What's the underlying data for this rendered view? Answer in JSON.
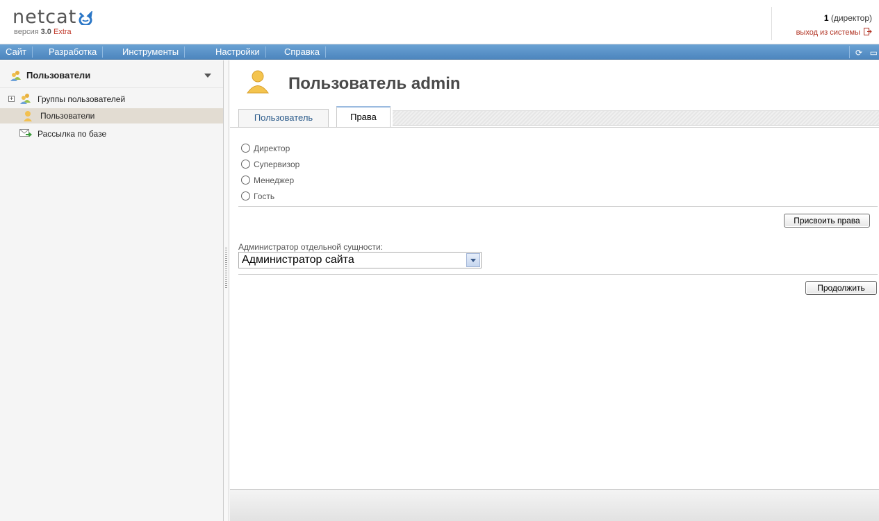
{
  "header": {
    "logo": "netcat",
    "version_prefix": "версия",
    "version_number": "3.0",
    "version_edition": "Extra",
    "user_id": "1",
    "user_role": "(директор)",
    "logout_label": "выход из системы"
  },
  "menu": {
    "items": [
      "Сайт",
      "Разработка",
      "Инструменты",
      "Настройки",
      "Справка"
    ]
  },
  "sidebar": {
    "title": "Пользователи",
    "items": [
      {
        "label": "Группы пользователей",
        "icon": "user-group-icon",
        "expandable": true
      },
      {
        "label": "Пользователи",
        "icon": "user-icon",
        "selected": true
      },
      {
        "label": "Рассылка по базе",
        "icon": "mail-send-icon"
      }
    ]
  },
  "main": {
    "title": "Пользователь admin",
    "tabs": [
      {
        "label": "Пользователь",
        "active": false
      },
      {
        "label": "Права",
        "active": true
      }
    ],
    "roles": [
      "Директор",
      "Супервизор",
      "Менеджер",
      "Гость"
    ],
    "assign_button": "Присвоить права",
    "entity_admin_label": "Администратор отдельной сущности:",
    "entity_admin_value": "Администратор сайта",
    "continue_button": "Продолжить"
  },
  "colors": {
    "menu_bar": "#5b93c9",
    "accent_red": "#c0392b",
    "selected_row": "#e2dcd2"
  }
}
